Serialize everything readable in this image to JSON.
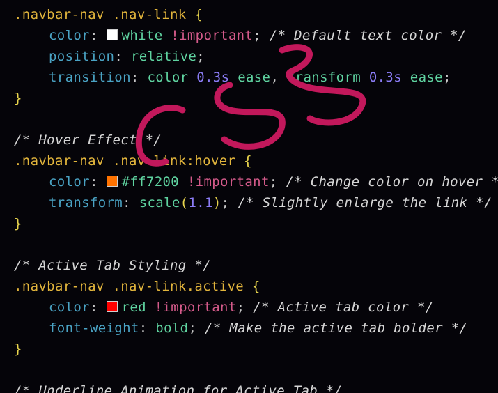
{
  "editor": {
    "language": "css",
    "annotation_text": "CSS",
    "annotation_color": "#c2185b",
    "swatches": {
      "white": "#ffffff",
      "orange": "#ff7200",
      "red": "#ff0000"
    },
    "blocks": [
      {
        "selector": ".navbar-nav .nav-link",
        "declarations": [
          {
            "property": "color",
            "value": "white",
            "important": "!important",
            "comment": "/* Default text color */"
          },
          {
            "property": "position",
            "value": "relative"
          },
          {
            "property": "transition",
            "value": "color",
            "num1": "0.3s",
            "value2": "ease",
            "sep": ",",
            "value3": "transform",
            "num2": "0.3s",
            "value4": "ease"
          }
        ]
      },
      {
        "comment": "/* Hover Effect */",
        "selector": ".navbar-nav .nav-link:hover",
        "declarations": [
          {
            "property": "color",
            "value": "#ff7200",
            "important": "!important",
            "comment": "/* Change color on hover */"
          },
          {
            "property": "transform",
            "func": "scale",
            "arg": "1.1",
            "comment": "/* Slightly enlarge the link */"
          }
        ]
      },
      {
        "comment": "/* Active Tab Styling */",
        "selector": ".navbar-nav .nav-link.active",
        "declarations": [
          {
            "property": "color",
            "value": "red",
            "important": "!important",
            "comment": "/* Active tab color */"
          },
          {
            "property": "font-weight",
            "value": "bold",
            "comment": "/* Make the active tab bolder */"
          }
        ]
      },
      {
        "comment": "/* Underline Animation for Active Tab */"
      }
    ],
    "punct": {
      "open": "{",
      "close": "}",
      "colon": ":",
      "semi": ";",
      "lparen": "(",
      "rparen": ")"
    }
  }
}
